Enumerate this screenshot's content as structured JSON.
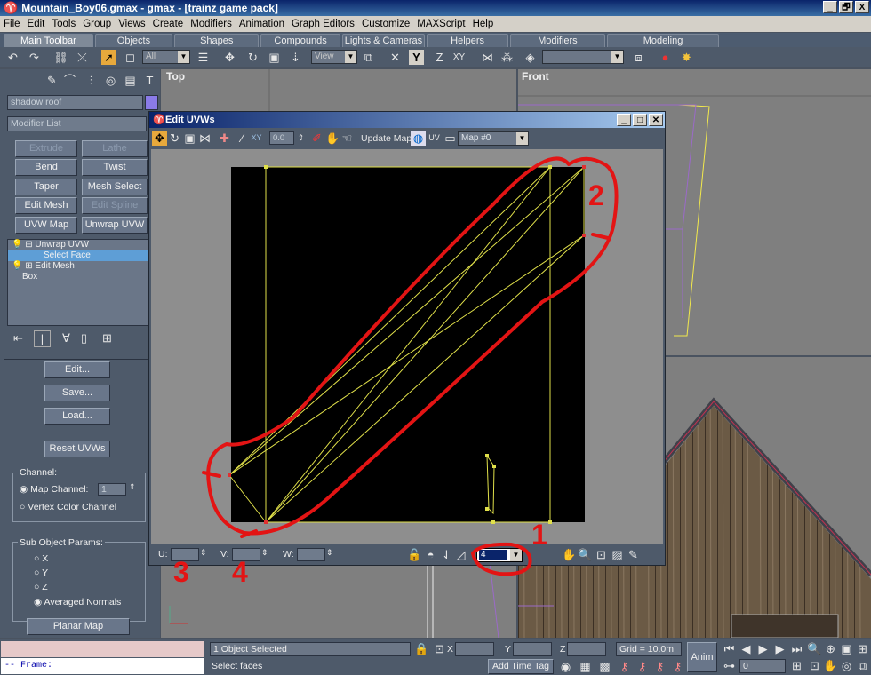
{
  "window": {
    "title": "Mountain_Boy06.gmax - gmax - [trainz game pack]",
    "minimize": "_",
    "restore": "🗗",
    "close": "X"
  },
  "menu": [
    "File",
    "Edit",
    "Tools",
    "Group",
    "Views",
    "Create",
    "Modifiers",
    "Animation",
    "Graph Editors",
    "Customize",
    "MAXScript",
    "Help"
  ],
  "tabs": [
    "Main Toolbar",
    "Objects",
    "Shapes",
    "Compounds",
    "Lights & Cameras",
    "Helpers",
    "Modifiers",
    "Modeling"
  ],
  "toolbar": {
    "selection_filter": "All",
    "ref_coord": "View",
    "axis_y": "Y",
    "axis_z": "Z",
    "axis_xy": "XY"
  },
  "command_panel": {
    "object_name": "shadow roof",
    "modifier_list": "Modifier List",
    "buttons": [
      {
        "label": "Extrude",
        "disabled": true
      },
      {
        "label": "Lathe",
        "disabled": true
      },
      {
        "label": "Bend",
        "disabled": false
      },
      {
        "label": "Twist",
        "disabled": false
      },
      {
        "label": "Taper",
        "disabled": false
      },
      {
        "label": "Mesh Select",
        "disabled": false
      },
      {
        "label": "Edit Mesh",
        "disabled": false
      },
      {
        "label": "Edit Spline",
        "disabled": true
      },
      {
        "label": "UVW Map",
        "disabled": false
      },
      {
        "label": "Unwrap UVW",
        "disabled": false
      }
    ],
    "stack": [
      "Unwrap UVW",
      "Select Face",
      "Edit Mesh",
      "Box"
    ],
    "edit_btn": "Edit...",
    "save_btn": "Save...",
    "load_btn": "Load...",
    "reset_btn": "Reset UVWs",
    "channel_group": "Channel:",
    "map_channel": "Map Channel:",
    "map_channel_value": "1",
    "vertex_color_channel": "Vertex Color Channel",
    "subobject_group": "Sub Object Params:",
    "axis_x": "X",
    "axis_y": "Y",
    "axis_z": "Z",
    "averaged_normals": "Averaged Normals",
    "planar_map": "Planar Map"
  },
  "viewports": {
    "top": "Top",
    "front": "Front"
  },
  "uvw_editor": {
    "title": "Edit UVWs",
    "spinner_value": "0.0",
    "update_map": "Update Map",
    "map_select": "Map #0",
    "u_label": "U:",
    "v_label": "V:",
    "w_label": "W:",
    "zoom_select": "4"
  },
  "annotations": [
    "1",
    "2",
    "3",
    "4"
  ],
  "status": {
    "selected": "1 Object Selected",
    "prompt": "Select faces",
    "x_label": "X",
    "y_label": "Y",
    "z_label": "Z",
    "grid": "Grid = 10.0m",
    "add_time_tag": "Add Time Tag",
    "anim": "Anim",
    "frame": "0",
    "maxscript": "-- Frame:"
  }
}
